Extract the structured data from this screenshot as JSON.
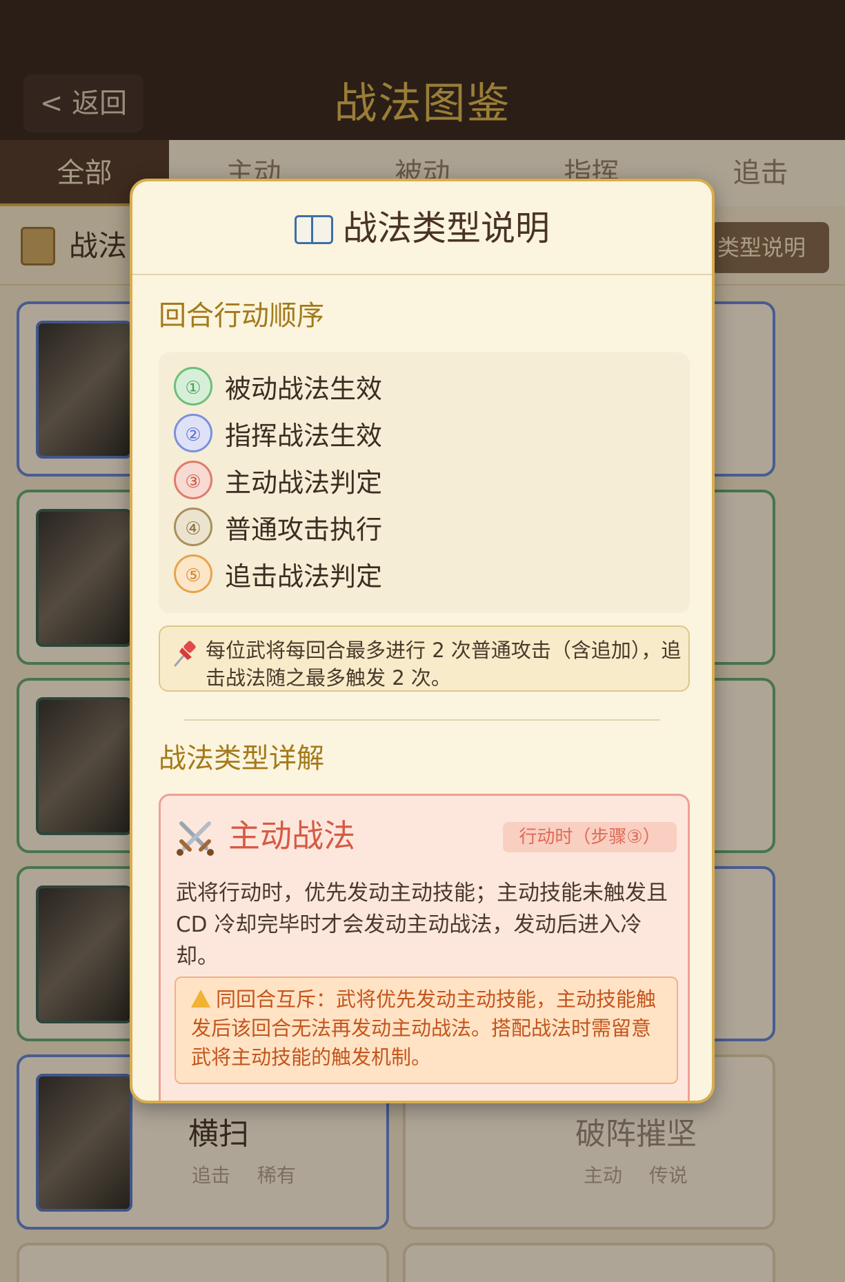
{
  "header": {
    "back_label": "< 返回",
    "title": "战法图鉴"
  },
  "tabs": [
    "全部",
    "主动",
    "被动",
    "指挥",
    "追击"
  ],
  "subbar": {
    "title": "战法",
    "type_button": "类型说明"
  },
  "cards": {
    "left_bottom": {
      "name": "横扫",
      "tags": [
        "追击",
        "稀有"
      ]
    },
    "right_bottom": {
      "name": "破阵摧坚",
      "tags": [
        "主动",
        "传说"
      ]
    }
  },
  "modal": {
    "title": "战法类型说明",
    "icon": "book-icon",
    "order_section_title": "回合行动顺序",
    "steps": [
      {
        "num": "①",
        "label": "被动战法生效",
        "color": "#6bbf7a"
      },
      {
        "num": "②",
        "label": "指挥战法生效",
        "color": "#7b8fe0"
      },
      {
        "num": "③",
        "label": "主动战法判定",
        "color": "#e07a6a"
      },
      {
        "num": "④",
        "label": "普通攻击执行",
        "color": "#a98f5d"
      },
      {
        "num": "⑤",
        "label": "追击战法判定",
        "color": "#e9a24a"
      }
    ],
    "note": "每位武将每回合最多进行 2 次普通攻击（含追加），追击战法随之最多触发 2 次。",
    "details_section_title": "战法类型详解",
    "active": {
      "title": "主动战法",
      "timing": "行动时（步骤③）",
      "description": "武将行动时，优先发动主动技能；主动技能未触发且 CD 冷却完毕时才会发动主动战法，发动后进入冷却。",
      "warning": "同回合互斥：武将优先发动主动技能，主动技能触发后该回合无法再发动主动战法。搭配战法时需留意武将主动技能的触发机制。"
    }
  }
}
